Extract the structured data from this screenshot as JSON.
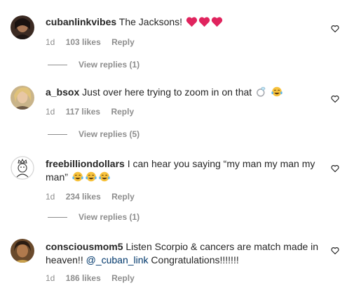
{
  "comments": [
    {
      "username": "cubanlinkvibes",
      "text": "The Jacksons!",
      "emojis": [
        "red-heart",
        "red-heart",
        "red-heart"
      ],
      "time": "1d",
      "likes": "103 likes",
      "reply": "Reply",
      "view_replies": "View replies (1)"
    },
    {
      "username": "a_bsox",
      "text": "Just over here trying to zoom in on that",
      "emojis": [
        "ring",
        "tears-of-joy"
      ],
      "time": "1d",
      "likes": "117 likes",
      "reply": "Reply",
      "view_replies": "View replies (5)"
    },
    {
      "username": "freebilliondollars",
      "text": "I can hear you saying “my man my man my man”",
      "emojis": [
        "tears-of-joy",
        "tears-of-joy",
        "tears-of-joy"
      ],
      "time": "1d",
      "likes": "234 likes",
      "reply": "Reply",
      "view_replies": "View replies (1)"
    },
    {
      "username": "consciousmom5",
      "text": "Listen Scorpio & cancers are match made in heaven!!",
      "mention": "@_cuban_link",
      "text_after": " Congratulations!!!!!!!",
      "time": "1d",
      "likes": "186 likes",
      "reply": "Reply"
    }
  ],
  "colors": {
    "text": "#262626",
    "secondary": "#8e8e8e",
    "mention": "#00376b",
    "heart_red": "#e0245e"
  }
}
